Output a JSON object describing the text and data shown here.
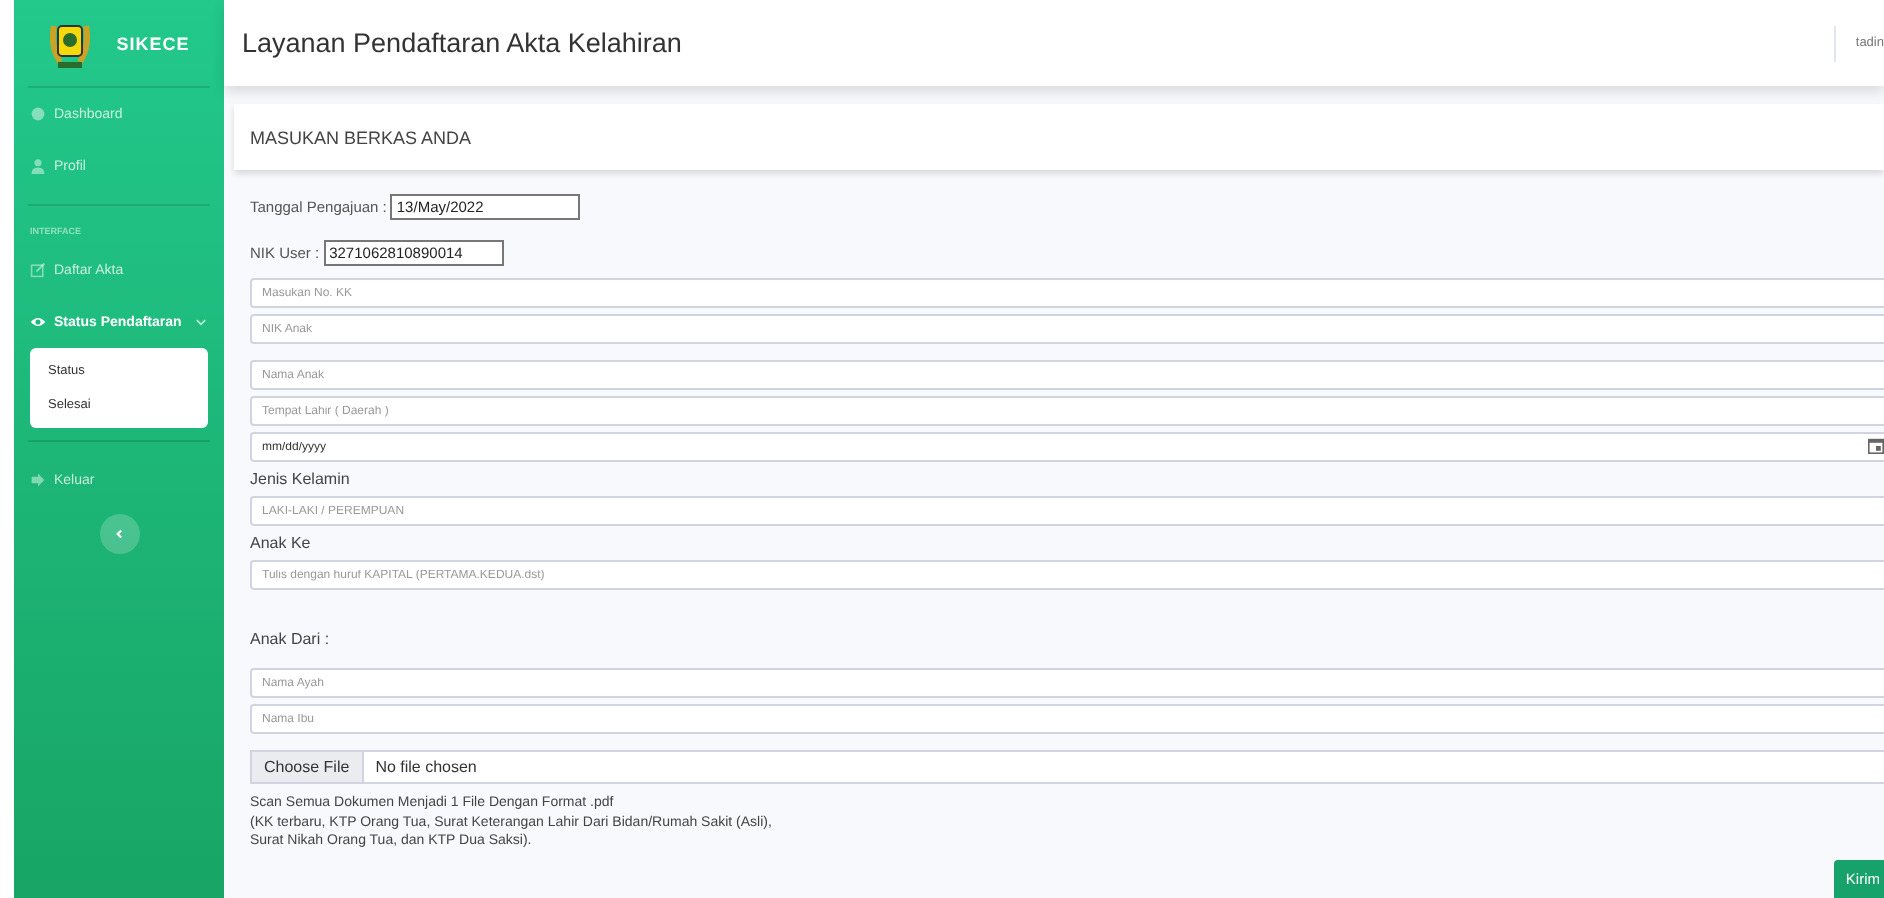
{
  "sidebar": {
    "brand": "SIKECE",
    "items": [
      {
        "kind": "link",
        "label": "Dashboard",
        "active": false
      },
      {
        "kind": "link",
        "label": "Profil",
        "active": false
      },
      {
        "kind": "divider"
      },
      {
        "kind": "heading",
        "label": "INTERFACE"
      },
      {
        "kind": "link",
        "label": "Daftar Akta",
        "active": false
      },
      {
        "kind": "group",
        "label": "Status Pendaftaran",
        "active": true,
        "expanded": true,
        "children": [
          {
            "label": "Status",
            "selected": false
          },
          {
            "label": "Selesai",
            "selected": false
          }
        ]
      },
      {
        "kind": "divider"
      },
      {
        "kind": "link",
        "label": "Keluar",
        "active": false
      }
    ]
  },
  "topbar": {
    "title": "Layanan Pendaftaran Akta Kelahiran",
    "user": "tadin"
  },
  "card": {
    "title": "MASUKAN BERKAS ANDA"
  },
  "form": [
    {
      "kind": "inline",
      "label": "Tanggal Pengajuan  :",
      "value": "13/May/2022"
    },
    {
      "kind": "inline",
      "label": "NIK User  :",
      "value": "3271062810890014"
    },
    {
      "kind": "input",
      "placeholder": "Masukan No. KK"
    },
    {
      "kind": "input",
      "placeholder": "NIK Anak"
    },
    {
      "kind": "input",
      "placeholder": "Nama Anak"
    },
    {
      "kind": "input",
      "placeholder": "Tempat Lahir ( Daerah )"
    },
    {
      "kind": "date",
      "value": "mm/dd/yyyy"
    },
    {
      "kind": "label",
      "text": "Jenis Kelamin"
    },
    {
      "kind": "input",
      "placeholder": "LAKI-LAKI / PEREMPUAN"
    },
    {
      "kind": "label",
      "text": "Anak Ke"
    },
    {
      "kind": "input",
      "placeholder": "Tulis dengan huruf KAPITAL (PERTAMA.KEDUA.dst)"
    },
    {
      "kind": "label",
      "text": "Anak Dari  :"
    },
    {
      "kind": "input",
      "placeholder": "Nama Ayah"
    },
    {
      "kind": "input",
      "placeholder": "Nama Ibu"
    },
    {
      "kind": "file",
      "button": "Choose File",
      "status": "No file chosen"
    },
    {
      "kind": "note",
      "lines": [
        "Scan Semua Dokumen Menjadi 1 File Dengan Format .pdf",
        "(KK terbaru, KTP Orang Tua, Surat Keterangan Lahir Dari Bidan/Rumah Sakit (Asli),",
        "Surat Nikah Orang Tua, dan KTP Dua Saksi)."
      ]
    }
  ],
  "submit": "Kirim"
}
